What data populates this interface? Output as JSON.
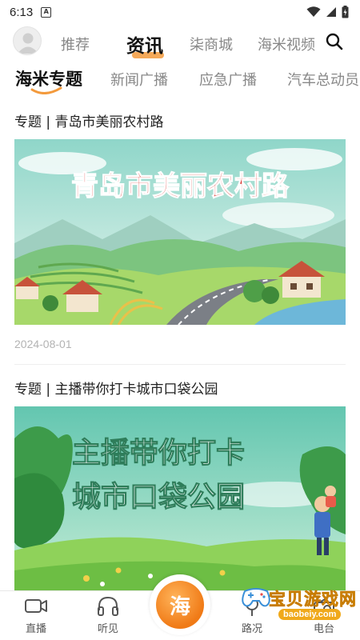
{
  "status_bar": {
    "time": "6:13",
    "app_badge": "A"
  },
  "top_nav": {
    "tabs": [
      {
        "label": "推荐"
      },
      {
        "label": "资讯"
      },
      {
        "label": "柒商城"
      },
      {
        "label": "海米视频"
      }
    ],
    "active_tab": "资讯"
  },
  "sub_nav": {
    "tabs": [
      {
        "label": "海米专题"
      },
      {
        "label": "新闻广播"
      },
      {
        "label": "应急广播"
      },
      {
        "label": "汽车总动员"
      }
    ],
    "active_tab": "海米专题"
  },
  "articles": [
    {
      "title": "专题 | 青岛市美丽农村路",
      "banner_text": "青岛市美丽农村路",
      "date": "2024-08-01"
    },
    {
      "title": "专题 | 主播带你打卡城市口袋公园",
      "banner_line1": "主播带你打卡",
      "banner_line2": "城市口袋公园"
    }
  ],
  "bottom_nav": {
    "items": [
      {
        "label": "直播",
        "icon": "video-camera-icon"
      },
      {
        "label": "听见",
        "icon": "headphones-icon"
      },
      {
        "label": "海",
        "icon": "center-hai-button"
      },
      {
        "label": "路况",
        "icon": "traffic-icon"
      },
      {
        "label": "电台",
        "icon": "radio-icon"
      }
    ]
  },
  "watermark": {
    "text": "宝贝游戏网",
    "url": "baobeiy.com"
  },
  "colors": {
    "accent": "#f39a3c",
    "center_button": "#f07a16",
    "watermark": "#f0a91b"
  }
}
